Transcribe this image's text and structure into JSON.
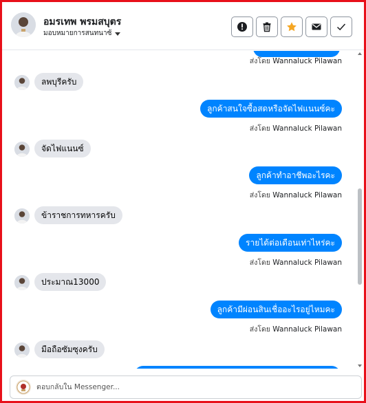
{
  "header": {
    "name": "อมรเทพ พรมสบุตร",
    "subtitle": "มอบหมายการสนทนาซ้",
    "buttons": [
      {
        "icon": "alert-icon",
        "label": "Mark as spam"
      },
      {
        "icon": "trash-icon",
        "label": "Delete"
      },
      {
        "icon": "star-icon",
        "label": "Star"
      },
      {
        "icon": "mail-icon",
        "label": "Mark unread"
      },
      {
        "icon": "check-icon",
        "label": "Mark done"
      }
    ]
  },
  "messages": [
    {
      "id": "m0",
      "direction": "out",
      "text": "",
      "sent_by_prefix": "ส่งโดย",
      "sent_by": "Wannaluck Pilawan"
    },
    {
      "id": "m1",
      "direction": "in",
      "text": "ลพบุรีครับ"
    },
    {
      "id": "m2",
      "direction": "out",
      "text": "ลูกค้าสนใจซื้อสดหรือจัดไฟแนนซ์คะ",
      "sent_by_prefix": "ส่งโดย",
      "sent_by": "Wannaluck Pilawan"
    },
    {
      "id": "m3",
      "direction": "in",
      "text": "จัดไฟแนนซ์"
    },
    {
      "id": "m4",
      "direction": "out",
      "text": "ลูกค้าทำอาชีพอะไรคะ",
      "sent_by_prefix": "ส่งโดย",
      "sent_by": "Wannaluck Pilawan"
    },
    {
      "id": "m5",
      "direction": "in",
      "text": "ข้าราชการทหารครับ"
    },
    {
      "id": "m6",
      "direction": "out",
      "text": "รายได้ต่อเดือนเท่าไหร่คะ",
      "sent_by_prefix": "ส่งโดย",
      "sent_by": "Wannaluck Pilawan"
    },
    {
      "id": "m7",
      "direction": "in",
      "text": "ประมาณ13000"
    },
    {
      "id": "m8",
      "direction": "out",
      "text": "ลูกค้ามีผ่อนสินเชื่ออะไรอยู่ไหมคะ",
      "sent_by_prefix": "ส่งโดย",
      "sent_by": "Wannaluck Pilawan"
    },
    {
      "id": "m9",
      "direction": "in",
      "text": "มือถือซัมซุงครับ"
    },
    {
      "id": "m10",
      "direction": "out",
      "text": ""
    }
  ],
  "composer": {
    "placeholder": "ตอบกลับใน Messenger..."
  },
  "colors": {
    "frame": "#e8101a",
    "outgoing_bubble": "#0084ff",
    "incoming_bubble": "#e4e6eb",
    "star": "#f5a623"
  }
}
